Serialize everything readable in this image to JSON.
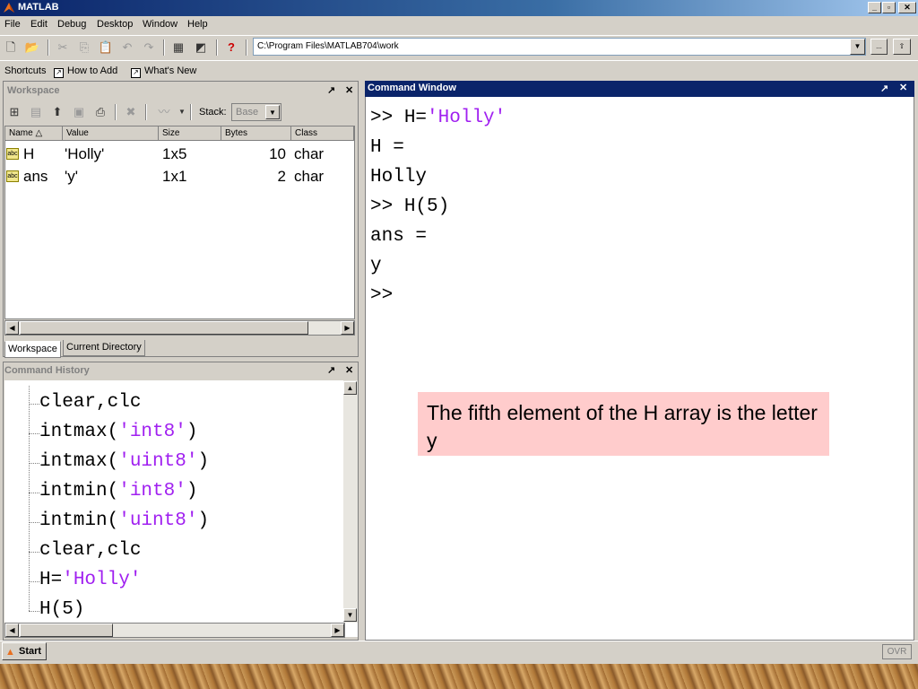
{
  "window": {
    "title": "MATLAB"
  },
  "menu": [
    "File",
    "Edit",
    "Debug",
    "Desktop",
    "Window",
    "Help"
  ],
  "toolbar": {
    "current_directory": "C:\\Program Files\\MATLAB704\\work",
    "browse_label": "..."
  },
  "shortcuts": {
    "label": "Shortcuts",
    "how_to_add": "How to Add",
    "whats_new": "What's New"
  },
  "workspace": {
    "title": "Workspace",
    "stack_label": "Stack:",
    "stack_value": "Base",
    "columns": [
      "Name △",
      "Value",
      "Size",
      "Bytes",
      "Class"
    ],
    "rows": [
      {
        "name": "H",
        "value": "'Holly'",
        "size": "1x5",
        "bytes": "10",
        "class": "char",
        "icon": "abc"
      },
      {
        "name": "ans",
        "value": "'y'",
        "size": "1x1",
        "bytes": "2",
        "class": "char",
        "icon": "abc"
      }
    ],
    "tabs": [
      "Workspace",
      "Current Directory"
    ]
  },
  "command_window": {
    "title": "Command Window",
    "lines": [
      {
        "prompt": ">> ",
        "code": "H=",
        "str": "'Holly'"
      },
      {
        "prompt": "",
        "code": "H =",
        "str": ""
      },
      {
        "prompt": "",
        "code": "Holly",
        "str": ""
      },
      {
        "prompt": ">> ",
        "code": "H(5)",
        "str": ""
      },
      {
        "prompt": "",
        "code": "ans =",
        "str": ""
      },
      {
        "prompt": "",
        "code": "y",
        "str": ""
      },
      {
        "prompt": ">>",
        "code": "",
        "str": ""
      }
    ]
  },
  "command_history": {
    "title": "Command History",
    "lines": [
      {
        "code": "clear,clc",
        "str": "",
        "close": ""
      },
      {
        "code": "intmax(",
        "str": "'int8'",
        "close": ")"
      },
      {
        "code": "intmax(",
        "str": "'uint8'",
        "close": ")"
      },
      {
        "code": "intmin(",
        "str": "'int8'",
        "close": ")"
      },
      {
        "code": "intmin(",
        "str": "'uint8'",
        "close": ")"
      },
      {
        "code": "clear,clc",
        "str": "",
        "close": ""
      },
      {
        "code": "H=",
        "str": "'Holly'",
        "close": ""
      },
      {
        "code": "H(5)",
        "str": "",
        "close": ""
      }
    ]
  },
  "callout": {
    "text": "The fifth element of the H array is the letter y"
  },
  "statusbar": {
    "start": "Start",
    "ovr": "OVR"
  },
  "colors": {
    "string": "#a020f0",
    "title_bar": "#0a246a",
    "callout_bg": "#ffcccc"
  }
}
